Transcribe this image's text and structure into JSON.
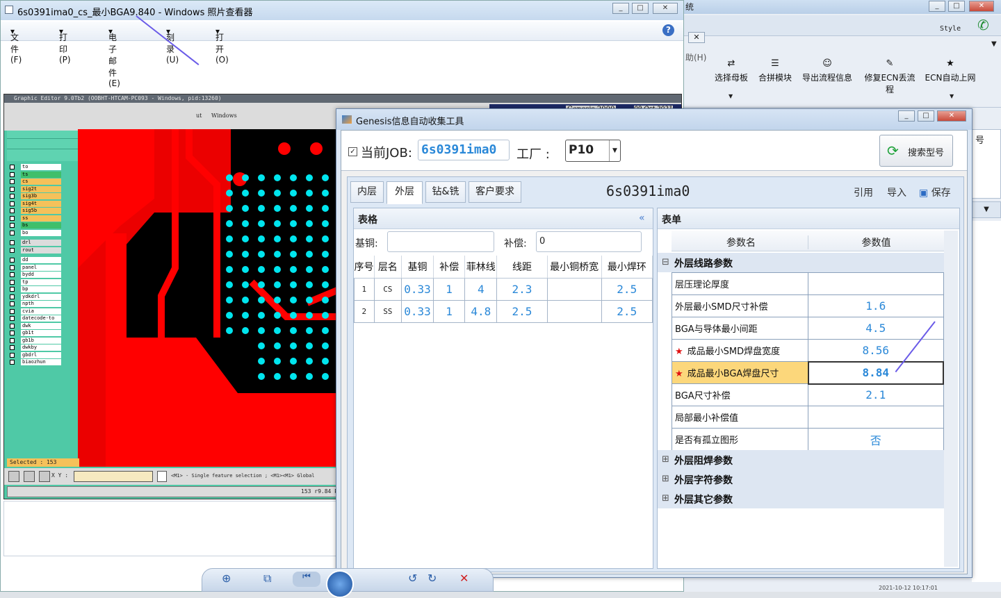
{
  "photo_viewer": {
    "title": "6s0391ima0_cs_最小BGA9.840 - Windows 照片查看器",
    "menu": [
      "文件(F)",
      "打印(P)",
      "电子邮件(E)",
      "刻录(U)",
      "打开(O)"
    ],
    "help_icon": "help-icon"
  },
  "background_app": {
    "title_fragment": "统",
    "help_fragment": "助(H)",
    "style_label": "Style",
    "toolbar": [
      "选择母板",
      "合拼模块",
      "导出流程信息",
      "修复ECN丢流程",
      "ECN自动上网"
    ],
    "side_fragment": "号"
  },
  "genesis_editor": {
    "title": "Graphic Editor 9.0Tb2 (OOBHT-HTCAM-PC093 - Windows, pid:13260)",
    "menu_fragment": "ut",
    "menu_windows": "Windows",
    "right_title": "Genesis 2000",
    "right_date": "09 Oct 2021",
    "layers": [
      "to",
      "ts",
      "cs",
      "sig2t",
      "sig3b",
      "sig4t",
      "sig5b",
      "ss",
      "bs",
      "bo",
      "drl",
      "rout",
      "dd",
      "panel",
      "bydd",
      "tp",
      "bp",
      "ydkdrl",
      "npth",
      "cvia",
      "datecode-to",
      "dwk",
      "gb1t",
      "gb1b",
      "dwkby",
      "gbdrl",
      "biaozhun"
    ],
    "selected": "Selected : 153",
    "xy_label": "X Y :",
    "status_hint": "<M1> - Single feature selection ; <M1><M1> Global",
    "footer": "153 r9.84 Pa"
  },
  "collector": {
    "title": "Genesis信息自动收集工具",
    "job_label": "当前JOB:",
    "job_value": "6s0391ima0",
    "factory_label": "工厂 :",
    "factory_value": "P10",
    "search_button": "搜索型号",
    "tabs": [
      "内层",
      "外层",
      "钻&铣",
      "客户要求"
    ],
    "active_tab": "外层",
    "job_heading": "6s0391ima0",
    "actions": {
      "cite": "引用",
      "import": "导入",
      "save": "保存"
    },
    "grid_panel": {
      "title": "表格",
      "base_copper_label": "基铜:",
      "base_copper_value": "",
      "compensation_label": "补偿:",
      "compensation_value": "0",
      "columns": [
        "序号",
        "层名",
        "基铜",
        "补偿",
        "菲林线",
        "线距",
        "最小铜桥宽",
        "最小焊环"
      ],
      "rows": [
        [
          "1",
          "CS",
          "0.33",
          "1",
          "4",
          "2.3",
          "",
          "2.5"
        ],
        [
          "2",
          "SS",
          "0.33",
          "1",
          "4.8",
          "2.5",
          "",
          "2.5"
        ]
      ]
    },
    "form_panel": {
      "title": "表单",
      "col_name": "参数名",
      "col_value": "参数值",
      "groups": {
        "outer_line": "外层线路参数",
        "outer_mask": "外层阻焊参数",
        "outer_silk": "外层字符参数",
        "outer_other": "外层其它参数"
      },
      "params": [
        {
          "name": "层压理论厚度",
          "value": "",
          "star": false
        },
        {
          "name": "外层最小SMD尺寸补偿",
          "value": "1.6",
          "star": false
        },
        {
          "name": "BGA与导体最小间距",
          "value": "4.5",
          "star": false
        },
        {
          "name": "成品最小SMD焊盘宽度",
          "value": "8.56",
          "star": true
        },
        {
          "name": "成品最小BGA焊盘尺寸",
          "value": "8.84",
          "star": true
        },
        {
          "name": "BGA尺寸补偿",
          "value": "2.1",
          "star": false
        },
        {
          "name": "局部最小补偿值",
          "value": "",
          "star": false
        },
        {
          "name": "是否有孤立图形",
          "value": "否",
          "star": false
        }
      ]
    }
  },
  "taskbar_clock": "2021-10-12 10:17:01",
  "colors": {
    "accent_blue": "#2a88d8",
    "highlight": "#fcd77b",
    "pcb_red": "#ff0000",
    "pcb_cyan": "#00e5ee"
  }
}
